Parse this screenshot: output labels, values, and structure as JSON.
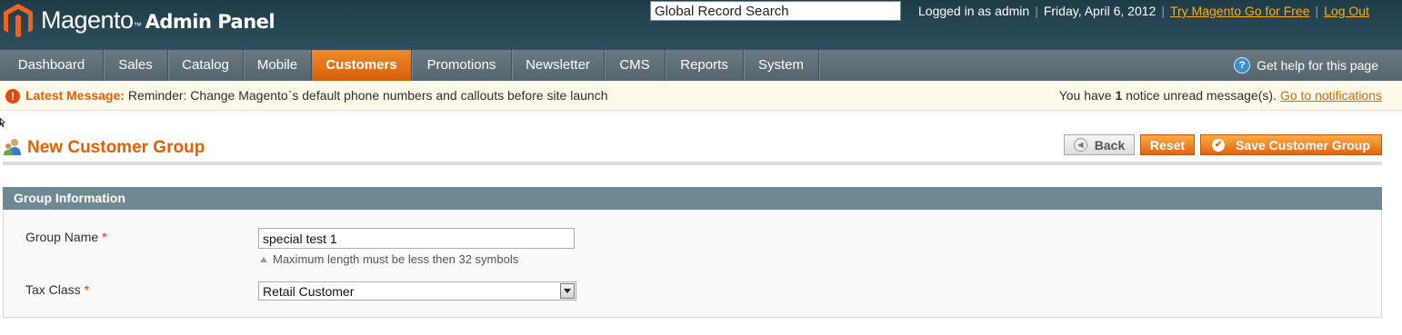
{
  "header": {
    "brand": "Magento",
    "tm": "™",
    "subtitle": "Admin Panel",
    "search_value": "Global Record Search",
    "logged_in": "Logged in as admin",
    "date": "Friday, April 6, 2012",
    "try_link": "Try Magento Go for Free",
    "logout": "Log Out",
    "separator": "|"
  },
  "nav": {
    "items": [
      {
        "label": "Dashboard"
      },
      {
        "label": "Sales"
      },
      {
        "label": "Catalog"
      },
      {
        "label": "Mobile"
      },
      {
        "label": "Customers",
        "active": true
      },
      {
        "label": "Promotions"
      },
      {
        "label": "Newsletter"
      },
      {
        "label": "CMS"
      },
      {
        "label": "Reports"
      },
      {
        "label": "System"
      }
    ],
    "help": "Get help for this page",
    "help_icon": "?"
  },
  "message": {
    "icon": "!",
    "label": "Latest Message:",
    "text": "Reminder: Change Magento`s default phone numbers and callouts before site launch",
    "notice_prefix": "You have",
    "notice_count": "1",
    "notice_suffix": "notice unread message(s).",
    "notice_link": "Go to notifications"
  },
  "page": {
    "title": "New Customer Group",
    "back": "Back",
    "reset": "Reset",
    "save": "Save Customer Group"
  },
  "section": {
    "title": "Group Information",
    "group_name_label": "Group Name",
    "required_mark": "*",
    "group_name_value": "special test 1",
    "group_name_note": "Maximum length must be less then 32 symbols",
    "tax_class_label": "Tax Class",
    "tax_class_value": "Retail Customer"
  },
  "colors": {
    "accent": "#eb5e00",
    "header_bg": "#1f3b48",
    "nav_bg": "#5d6d73",
    "section_bg": "#6f8992"
  }
}
